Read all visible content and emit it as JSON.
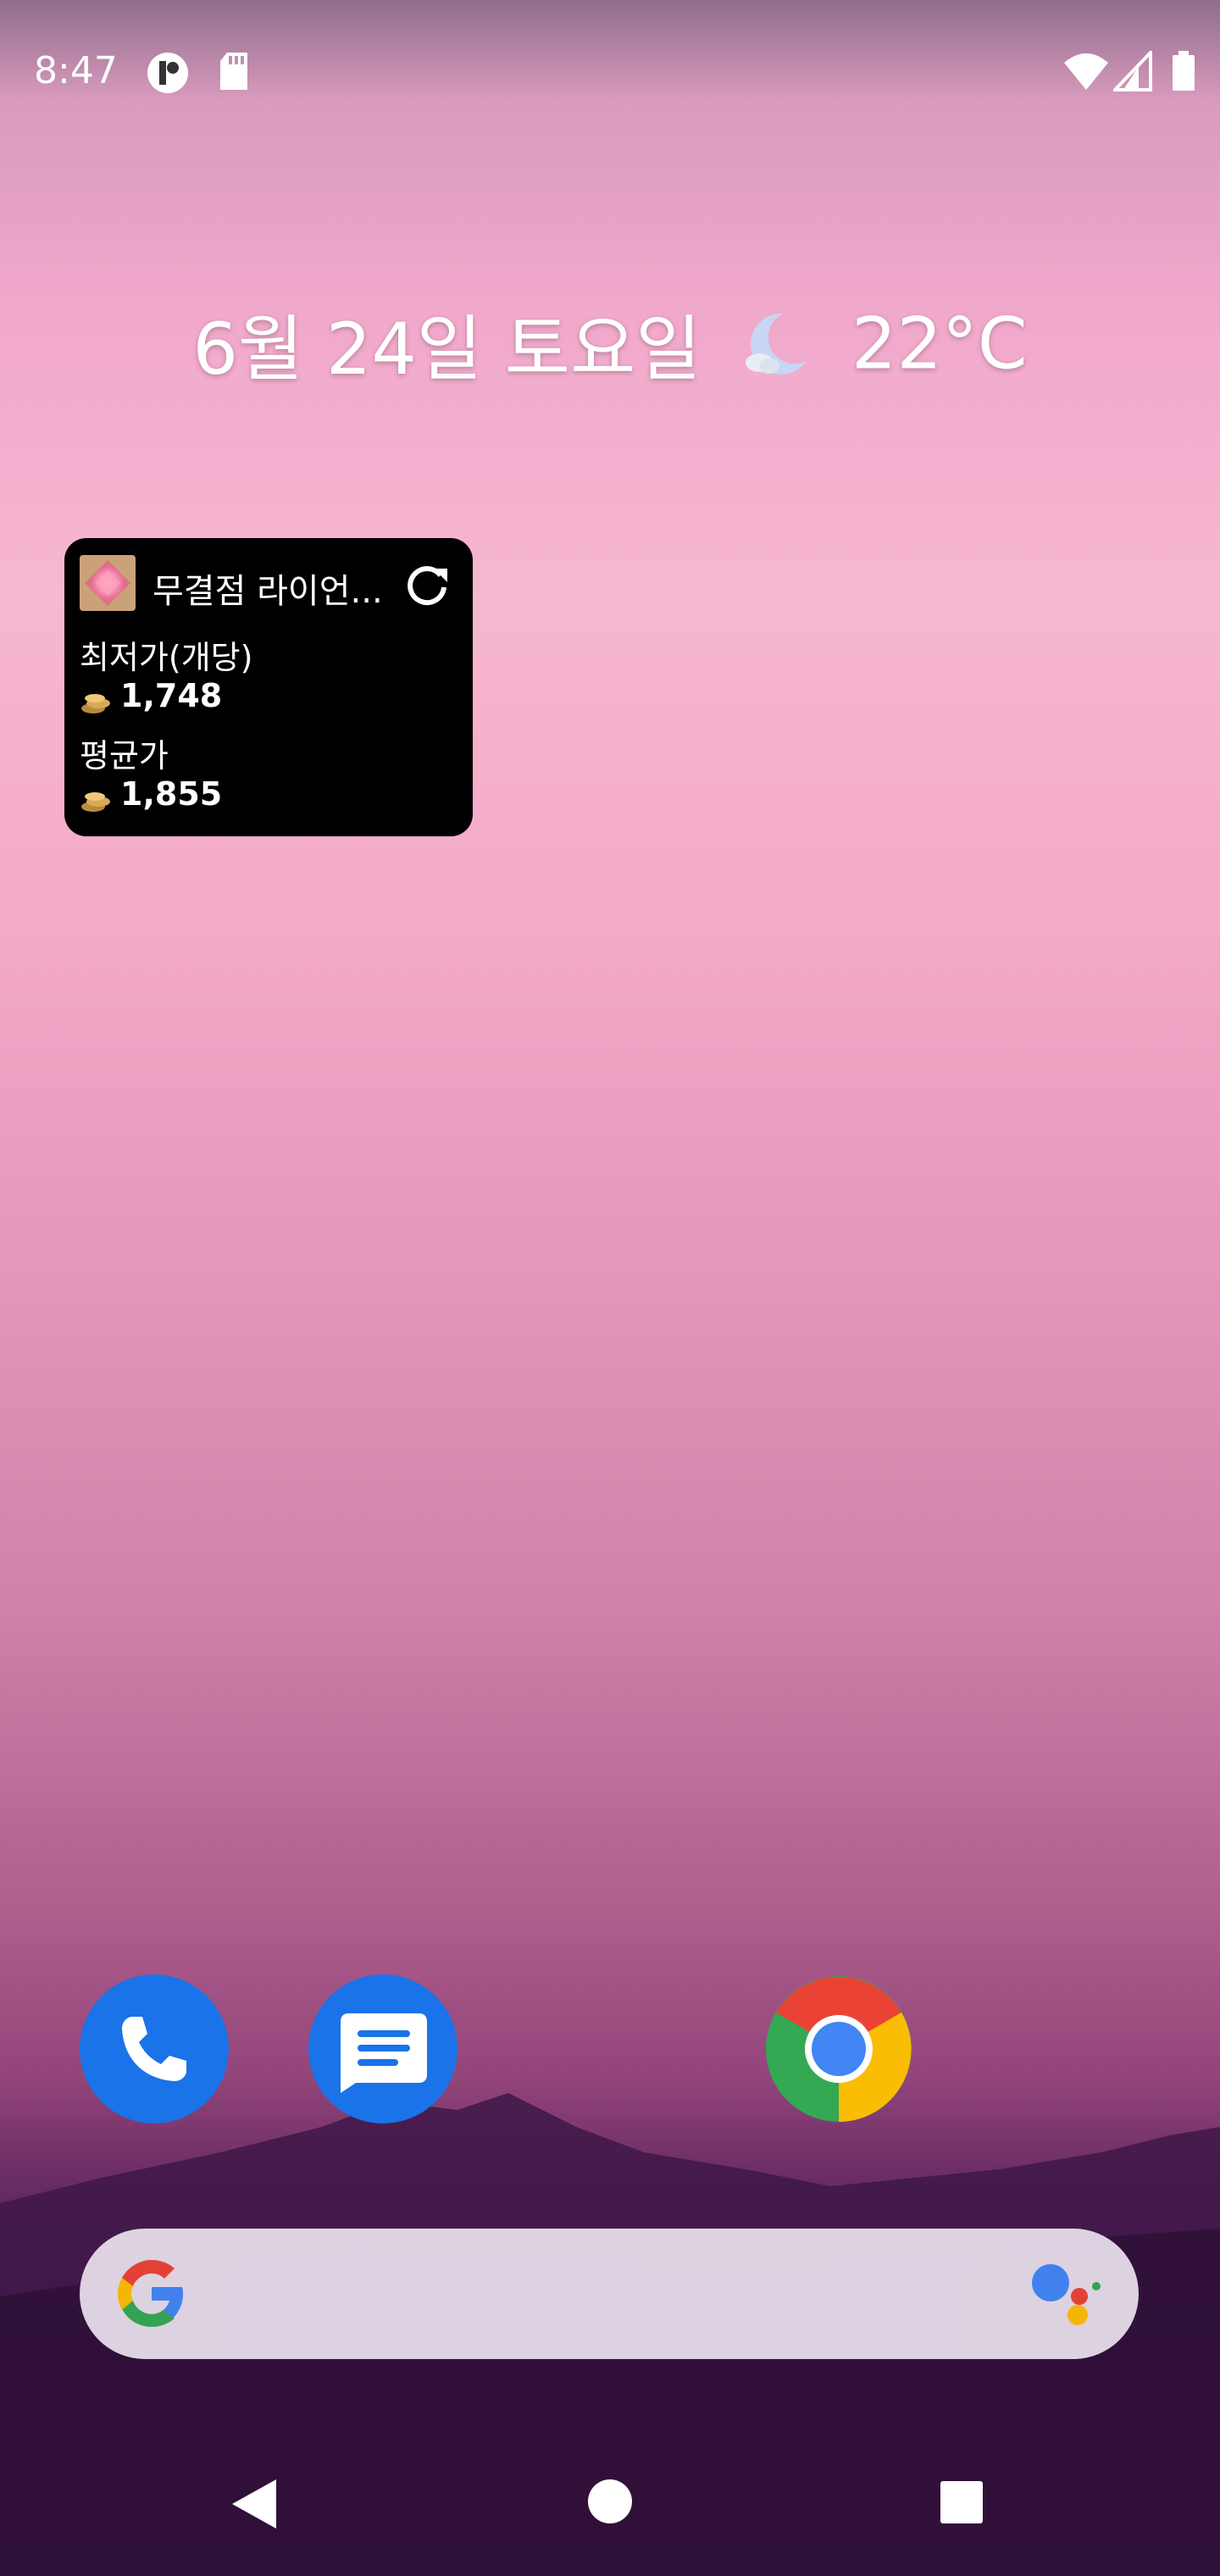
{
  "status_bar": {
    "time": "8:47",
    "left_icons": [
      "notification-app-icon",
      "sd-card-icon"
    ],
    "right_icons": [
      "wifi-icon",
      "cell-signal-icon",
      "battery-icon"
    ]
  },
  "at_a_glance": {
    "date": "6월 24일 토요일",
    "weather_icon": "moon-cloud-icon",
    "temperature": "22°C"
  },
  "widget": {
    "title": "무결점 라이언...",
    "refresh_icon": "refresh-icon",
    "lowest_label": "최저가(개당)",
    "lowest_value": "1,748",
    "average_label": "평균가",
    "average_value": "1,855",
    "currency_icon": "gold-coins-icon"
  },
  "dock": {
    "apps": [
      {
        "name": "Phone",
        "icon": "phone-icon"
      },
      {
        "name": "Messages",
        "icon": "messages-icon"
      },
      {
        "name": "Chrome",
        "icon": "chrome-icon"
      }
    ]
  },
  "search_bar": {
    "left_icon": "google-g-icon",
    "right_icon": "google-assistant-icon"
  },
  "nav_bar": {
    "buttons": [
      "back-icon",
      "home-icon",
      "recents-icon"
    ]
  },
  "colors": {
    "widget_bg": "#000000",
    "dock_blue": "#1a73e8",
    "search_bg": "#e3d9e6"
  }
}
